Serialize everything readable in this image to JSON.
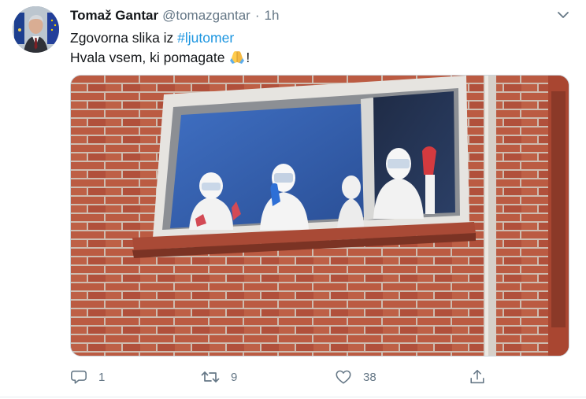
{
  "tweet": {
    "author": {
      "display_name": "Tomaž Gantar",
      "handle": "@tomazgantar",
      "separator": "·",
      "timestamp": "1h"
    },
    "text": {
      "line1_prefix": "Zgovorna slika iz ",
      "hashtag": "#ljutomer",
      "line2_prefix": "Hvala vsem, ki pomagate ",
      "line2_emoji": "folded-hands-emoji",
      "line2_suffix": "!"
    },
    "media": {
      "description_icon": "photo"
    },
    "actions": {
      "reply_count": "1",
      "retweet_count": "9",
      "like_count": "38",
      "reply_icon": "reply-icon",
      "retweet_icon": "retweet-icon",
      "like_icon": "heart-icon",
      "share_icon": "share-icon"
    },
    "colors": {
      "hashtag": "#1b95e0",
      "secondary_text": "#657786",
      "primary_text": "#14171a"
    }
  }
}
